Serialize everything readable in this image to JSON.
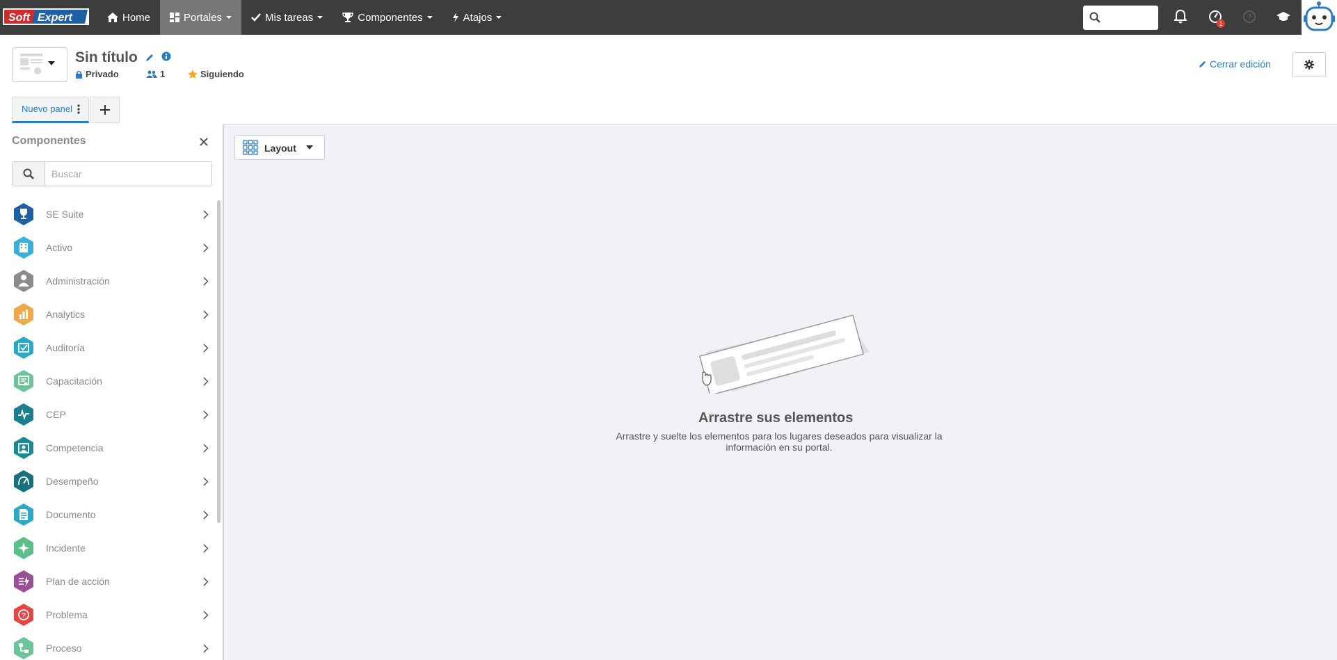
{
  "brand": {
    "logo_soft": "Soft",
    "logo_expert": "Expert"
  },
  "nav": {
    "items": [
      {
        "label": "Home",
        "icon": "home-icon"
      },
      {
        "label": "Portales",
        "icon": "dashboard-icon"
      },
      {
        "label": "Mis tareas",
        "icon": "check-icon"
      },
      {
        "label": "Componentes",
        "icon": "trophy-icon"
      },
      {
        "label": "Atajos",
        "icon": "bolt-icon"
      }
    ],
    "notification_badge": "1"
  },
  "portal": {
    "title": "Sin título",
    "privacy": "Privado",
    "members": "1",
    "following": "Siguiendo",
    "close_edit": "Cerrar edición"
  },
  "tabs": [
    {
      "label": "Nuevo panel"
    }
  ],
  "components_panel": {
    "title": "Componentes",
    "search_placeholder": "Buscar",
    "items": [
      {
        "label": "SE Suite",
        "color": "#1f5fa6",
        "icon": "trophy-icon"
      },
      {
        "label": "Activo",
        "color": "#3ab0d8",
        "icon": "building-icon"
      },
      {
        "label": "Administración",
        "color": "#8c8c8c",
        "icon": "person-icon"
      },
      {
        "label": "Analytics",
        "color": "#f0a94a",
        "icon": "bar-chart-icon"
      },
      {
        "label": "Auditoría",
        "color": "#2aaac6",
        "icon": "audit-icon"
      },
      {
        "label": "Capacitación",
        "color": "#6cc49a",
        "icon": "certificate-icon"
      },
      {
        "label": "CEP",
        "color": "#1b7f8e",
        "icon": "line-chart-icon"
      },
      {
        "label": "Competencia",
        "color": "#1b8a92",
        "icon": "badge-icon"
      },
      {
        "label": "Desempeño",
        "color": "#17707e",
        "icon": "gauge-icon"
      },
      {
        "label": "Documento",
        "color": "#2aaac6",
        "icon": "document-icon"
      },
      {
        "label": "Incidente",
        "color": "#5cbf8a",
        "icon": "incident-icon"
      },
      {
        "label": "Plan de acción",
        "color": "#9b4f96",
        "icon": "action-plan-icon"
      },
      {
        "label": "Problema",
        "color": "#e64545",
        "icon": "problem-icon"
      },
      {
        "label": "Proceso",
        "color": "#6cc49a",
        "icon": "process-icon"
      }
    ]
  },
  "layout_button": {
    "label": "Layout"
  },
  "empty_state": {
    "title": "Arrastre sus elementos",
    "description": "Arrastre y suelte los elementos para los lugares deseados para visualizar la información en su portal."
  }
}
